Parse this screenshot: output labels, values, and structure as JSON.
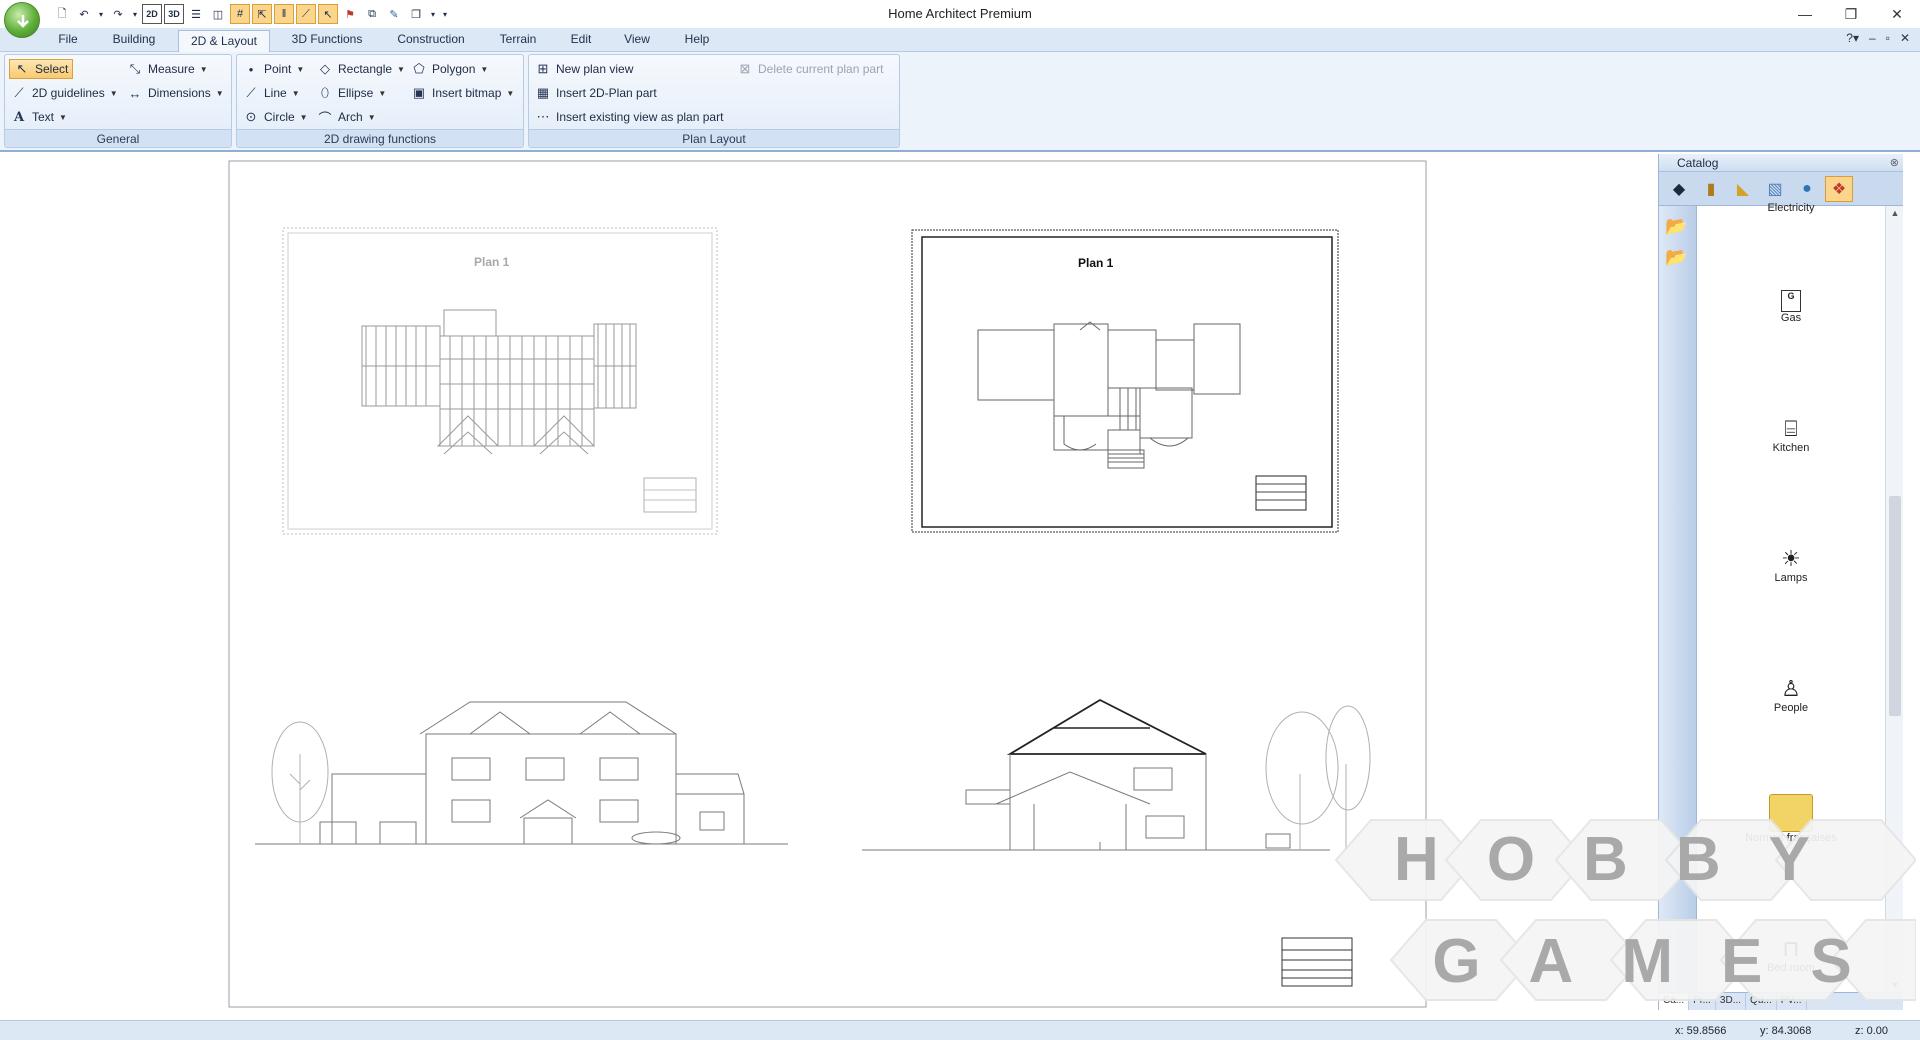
{
  "window": {
    "title": "Home Architect Premium"
  },
  "quick_access": {
    "view_2d": "2D",
    "view_3d": "3D"
  },
  "menu": {
    "tabs": [
      "File",
      "Building",
      "2D & Layout",
      "3D Functions",
      "Construction",
      "Terrain",
      "Edit",
      "View",
      "Help"
    ],
    "active": "2D & Layout"
  },
  "ribbon": {
    "general": {
      "title": "General",
      "select": "Select",
      "measure": "Measure",
      "guidelines": "2D guidelines",
      "dimensions": "Dimensions",
      "text": "Text"
    },
    "drawing": {
      "title": "2D drawing functions",
      "point": "Point",
      "rectangle": "Rectangle",
      "polygon": "Polygon",
      "line": "Line",
      "ellipse": "Ellipse",
      "insert_bitmap": "Insert bitmap",
      "circle": "Circle",
      "arch": "Arch"
    },
    "layout": {
      "title": "Plan Layout",
      "new_plan_view": "New plan view",
      "insert_2d_part": "Insert 2D-Plan part",
      "insert_existing": "Insert existing view as plan part",
      "delete_part": "Delete current plan part"
    }
  },
  "canvas": {
    "plan_left_label": "Plan 1",
    "plan_right_label": "Plan 1"
  },
  "catalog": {
    "title": "Catalog",
    "items": [
      "Electricity",
      "Gas",
      "Kitchen",
      "Lamps",
      "People",
      "Normes françaises",
      "Bed room"
    ],
    "gas_symbol": "G",
    "bottom_tabs": [
      "Ca...",
      "Pr...",
      "3D...",
      "Qu...",
      "PV..."
    ]
  },
  "status": {
    "x": "x: 59.8566",
    "y": "y: 84.3068",
    "z": "z: 0.00"
  },
  "watermark": {
    "line1": "HOBBY",
    "line2": "GAMES"
  }
}
